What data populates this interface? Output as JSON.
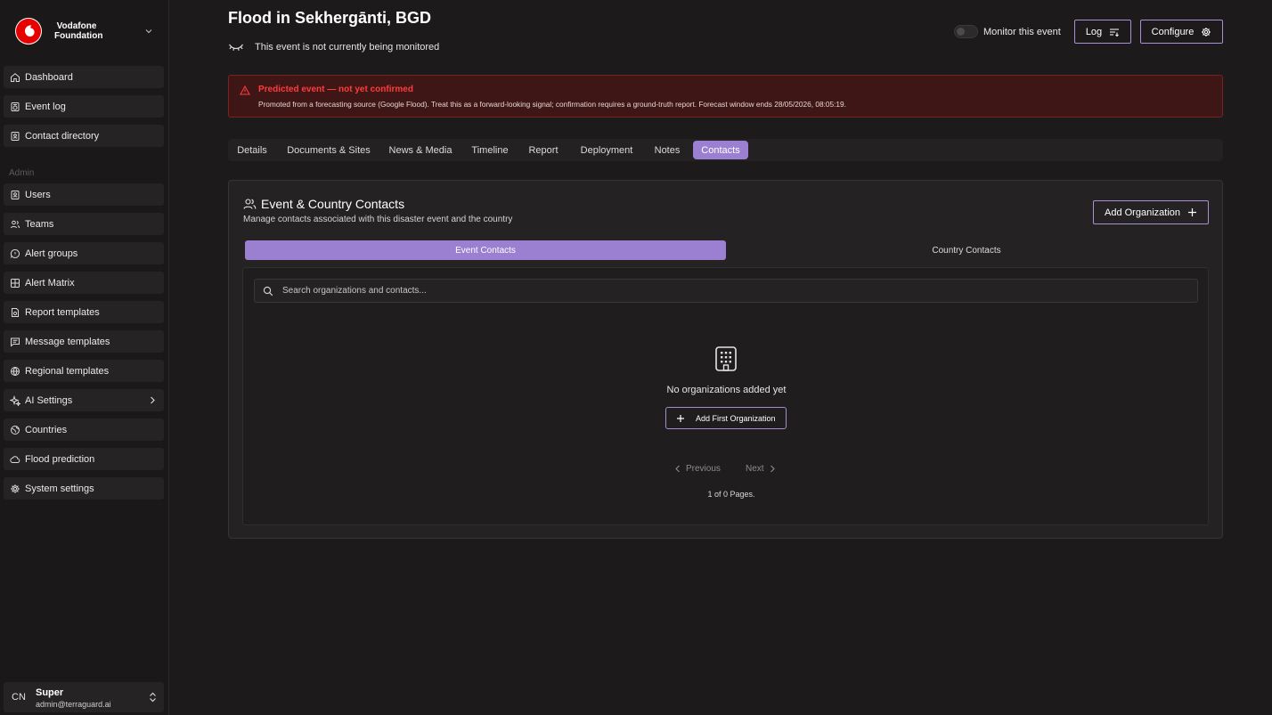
{
  "brand": {
    "line1": "Vodafone",
    "line2": "Foundation"
  },
  "sidebar": {
    "items": [
      {
        "label": "Dashboard",
        "icon": "home-icon"
      },
      {
        "label": "Event log",
        "icon": "event-log-icon"
      },
      {
        "label": "Contact directory",
        "icon": "contact-book-icon"
      }
    ],
    "admin_section_label": "Admin",
    "admin_items": [
      {
        "label": "Users",
        "icon": "user-badge-icon"
      },
      {
        "label": "Teams",
        "icon": "users-icon"
      },
      {
        "label": "Alert groups",
        "icon": "alert-bubble-icon"
      },
      {
        "label": "Alert Matrix",
        "icon": "grid-icon"
      },
      {
        "label": "Report templates",
        "icon": "report-icon"
      },
      {
        "label": "Message templates",
        "icon": "message-icon"
      },
      {
        "label": "Regional templates",
        "icon": "globe-icon"
      },
      {
        "label": "AI Settings",
        "icon": "sparkles-icon"
      },
      {
        "label": "Countries",
        "icon": "earth-icon"
      },
      {
        "label": "Flood prediction",
        "icon": "cloud-icon"
      },
      {
        "label": "System settings",
        "icon": "gear-icon"
      }
    ]
  },
  "user": {
    "initials": "CN",
    "name": "Super",
    "email": "admin@terraguard.ai"
  },
  "header": {
    "title": "Flood in Sekhergānti, BGD",
    "monitor_status": "This event is not currently being monitored",
    "monitor_toggle_label": "Monitor this event",
    "monitor_toggle_on": false,
    "log_label": "Log",
    "configure_label": "Configure"
  },
  "alert": {
    "title": "Predicted event — not yet confirmed",
    "text": "Promoted from a forecasting source (Google Flood). Treat this as a forward-looking signal; confirmation requires a ground-truth report. Forecast window ends 28/05/2026, 08:05:19.",
    "color": "#ff3b3b"
  },
  "tabs": [
    "Details",
    "Documents & Sites",
    "News & Media",
    "Timeline",
    "Report",
    "Deployment",
    "Notes",
    "Contacts"
  ],
  "active_tab": "Contacts",
  "contacts": {
    "title": "Event & Country Contacts",
    "subtitle": "Manage contacts associated with this disaster event and the country",
    "add_org_label": "Add Organization",
    "subtabs": [
      "Event Contacts",
      "Country Contacts"
    ],
    "active_subtab": "Event Contacts",
    "search_placeholder": "Search organizations and contacts...",
    "empty_text": "No organizations added yet",
    "add_first_label": "Add First Organization",
    "previous_label": "Previous",
    "next_label": "Next",
    "pages_text": "1 of 0 Pages."
  },
  "colors": {
    "accent": "#9b7fd1",
    "background": "#1c1a1b",
    "alert_bg": "#3e1616"
  }
}
